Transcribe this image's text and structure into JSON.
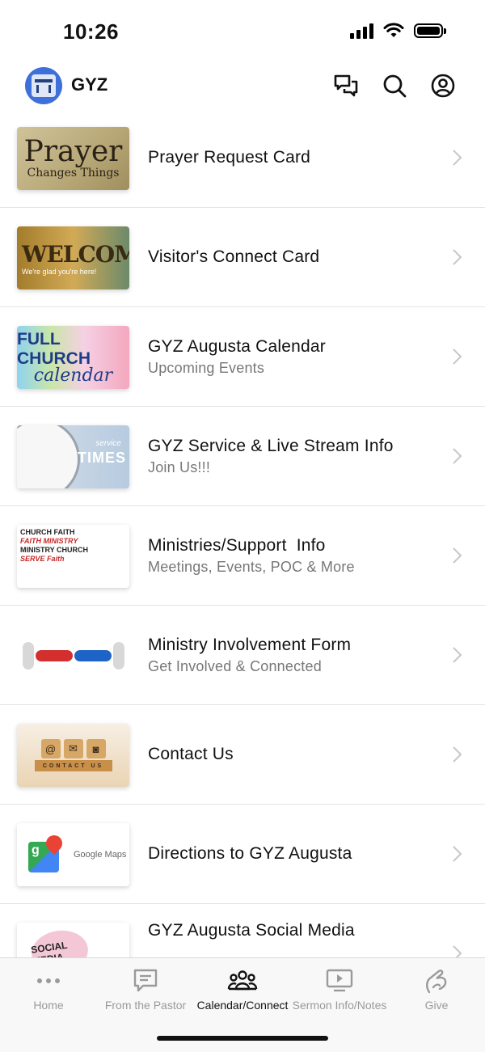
{
  "status_bar": {
    "time": "10:26"
  },
  "header": {
    "title": "GYZ"
  },
  "items": [
    {
      "title": "Prayer Request Card",
      "subtitle": "",
      "thumb": {
        "big": "Prayer",
        "small": "Changes Things"
      }
    },
    {
      "title": "Visitor's Connect Card",
      "subtitle": "",
      "thumb": {
        "big": "WELCOME",
        "small": "We're glad you're here!"
      }
    },
    {
      "title": "GYZ Augusta Calendar",
      "subtitle": "Upcoming Events",
      "thumb": {
        "big": "FULL CHURCH",
        "small": "calendar"
      }
    },
    {
      "title": "GYZ Service & Live Stream Info",
      "subtitle": "Join Us!!!",
      "thumb": {
        "big": "TIMES",
        "small": "service"
      }
    },
    {
      "title": "Ministries/Support  Info",
      "subtitle": "Meetings, Events, POC & More",
      "thumb": {
        "line1": "CHURCH  FAITH",
        "line2": "FAITH  MINISTRY",
        "line3": "MINISTRY  CHURCH",
        "line4": "SERVE  Faith"
      }
    },
    {
      "title": "Ministry Involvement Form",
      "subtitle": "Get Involved & Connected"
    },
    {
      "title": "Contact Us",
      "subtitle": "",
      "thumb": {
        "big": "CONTACT US"
      }
    },
    {
      "title": "Directions to GYZ Augusta",
      "subtitle": "",
      "thumb": {
        "big": "Google Maps",
        "small": "g"
      }
    },
    {
      "title": "GYZ Augusta Social Media",
      "subtitle": "",
      "thumb": {
        "big": "SOCIAL MEDIA"
      }
    }
  ],
  "tabs": [
    {
      "label": "Home",
      "icon": "more-dots-icon",
      "active": false
    },
    {
      "label": "From the Pastor",
      "icon": "message-icon",
      "active": false
    },
    {
      "label": "Calendar/Connect",
      "icon": "people-icon",
      "active": true
    },
    {
      "label": "Sermon Info/Notes",
      "icon": "monitor-play-icon",
      "active": false
    },
    {
      "label": "Give",
      "icon": "give-hand-icon",
      "active": false
    }
  ]
}
